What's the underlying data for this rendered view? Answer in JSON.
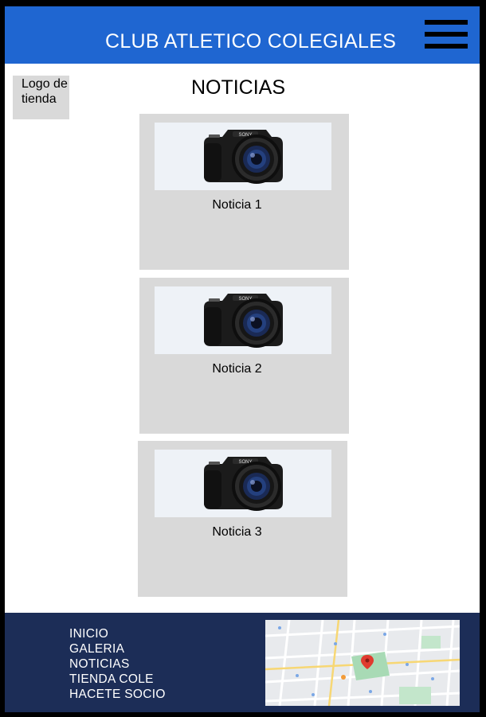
{
  "header": {
    "site_title": "CLUB ATLETICO COLEGIALES",
    "menu_icon": "hamburger-menu-icon",
    "color": "#1f66d1"
  },
  "logo": {
    "label": "Logo de tienda"
  },
  "main": {
    "title": "NOTICIAS",
    "news": [
      {
        "label": "Noticia 1",
        "image_icon": "camera-icon"
      },
      {
        "label": "Noticia 2",
        "image_icon": "camera-icon"
      },
      {
        "label": "Noticia 3",
        "image_icon": "camera-icon"
      }
    ]
  },
  "footer": {
    "color": "#1c2d57",
    "links": [
      "INICIO",
      "GALERIA",
      "NOTICIAS",
      "TIENDA COLE",
      "HACETE SOCIO"
    ],
    "map_icon": "map-location-icon"
  }
}
